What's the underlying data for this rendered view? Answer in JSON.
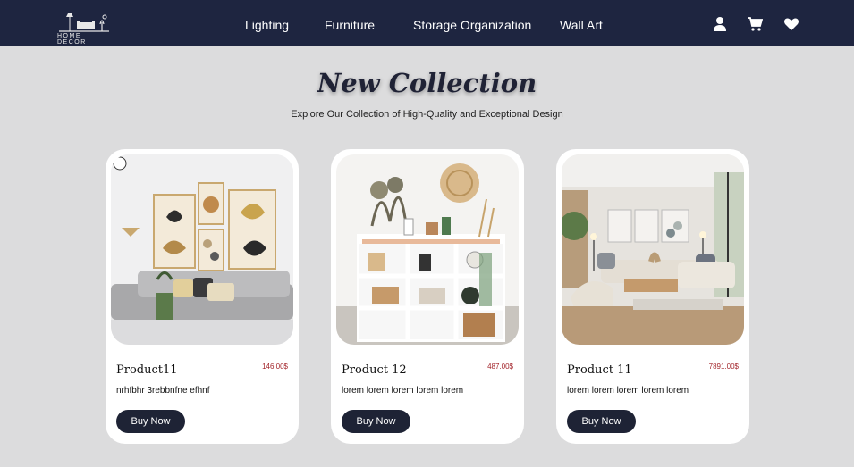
{
  "nav": {
    "logo_text": "HOME DECOR",
    "links": [
      {
        "label": "Lighting"
      },
      {
        "label": "Furniture"
      },
      {
        "label": "Storage Organization"
      },
      {
        "label": "Wall Art"
      }
    ],
    "icons": [
      "user-icon",
      "cart-icon",
      "heart-icon"
    ]
  },
  "hero": {
    "title": "New Collection",
    "subtitle": "Explore Our Collection of High-Quality and Exceptional Design"
  },
  "products": [
    {
      "name": "Product11",
      "price": "146.00$",
      "description": "nrhfbhr 3rebbnfne efhnf",
      "button": "Buy Now"
    },
    {
      "name": "Product 12",
      "price": "487.00$",
      "description": "lorem lorem lorem lorem lorem",
      "button": "Buy Now"
    },
    {
      "name": "Product 11",
      "price": "7891.00$",
      "description": "lorem lorem lorem lorem lorem",
      "button": "Buy Now"
    }
  ],
  "colors": {
    "navbar": "#1e2540",
    "background": "#dcdcdd",
    "price": "#a3252b",
    "button": "#1e2335"
  }
}
